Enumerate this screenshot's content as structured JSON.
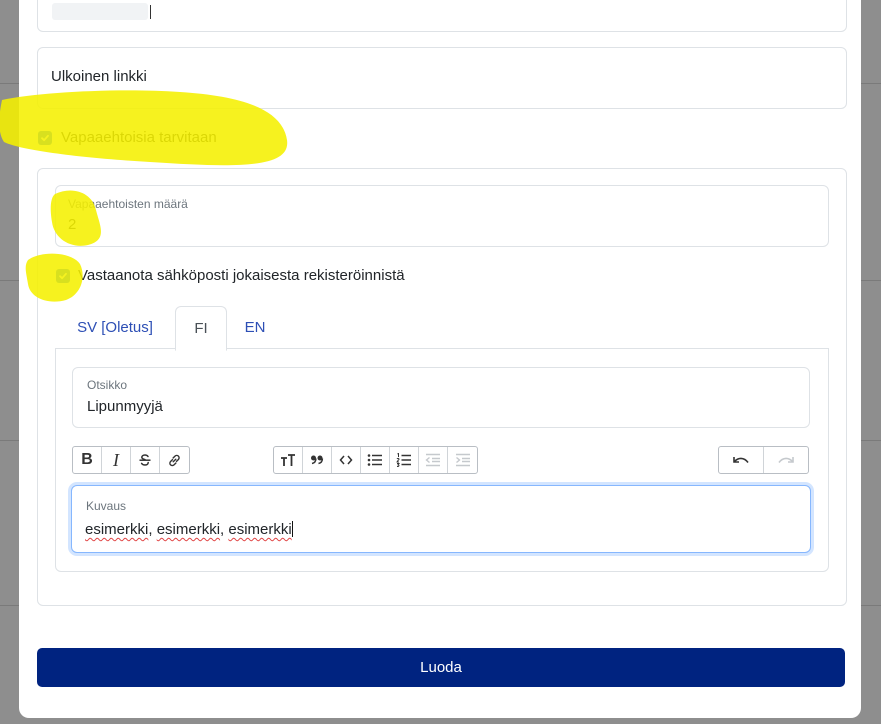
{
  "form": {
    "external_link_label": "Ulkoinen linkki",
    "volunteers_needed_label": "Vapaaehtoisia tarvitaan",
    "volunteers_needed_checked": true,
    "volunteer_count_label": "Vapaaehtoisten määrä",
    "volunteer_count_value": "2",
    "email_on_registration_label": "Vastaanota sähköposti jokaisesta rekisteröinnistä",
    "email_on_registration_checked": true
  },
  "tabs": [
    {
      "label": "SV [Oletus]",
      "active": false
    },
    {
      "label": "FI",
      "active": true
    },
    {
      "label": "EN",
      "active": false
    }
  ],
  "title_field": {
    "label": "Otsikko",
    "value": "Lipunmyyjä"
  },
  "toolbar": {
    "groups": [
      [
        "bold-icon",
        "italic-icon",
        "strikethrough-icon",
        "link-icon"
      ],
      [
        "text-size-icon",
        "quote-icon",
        "code-icon",
        "bullet-list-icon",
        "numbered-list-icon",
        "outdent-icon",
        "indent-icon"
      ],
      [
        "undo-icon",
        "redo-icon"
      ]
    ],
    "bold_glyph": "B",
    "italic_glyph": "I"
  },
  "description_field": {
    "label": "Kuvaus",
    "words": [
      "esimerkki",
      "esimerkki",
      "esimerkki"
    ],
    "separator": ", "
  },
  "submit_label": "Luoda",
  "colors": {
    "primary": "#002380",
    "checkbox": "#0d6efd",
    "tab_link": "#2d4fb5",
    "highlight": "#f5f000"
  }
}
